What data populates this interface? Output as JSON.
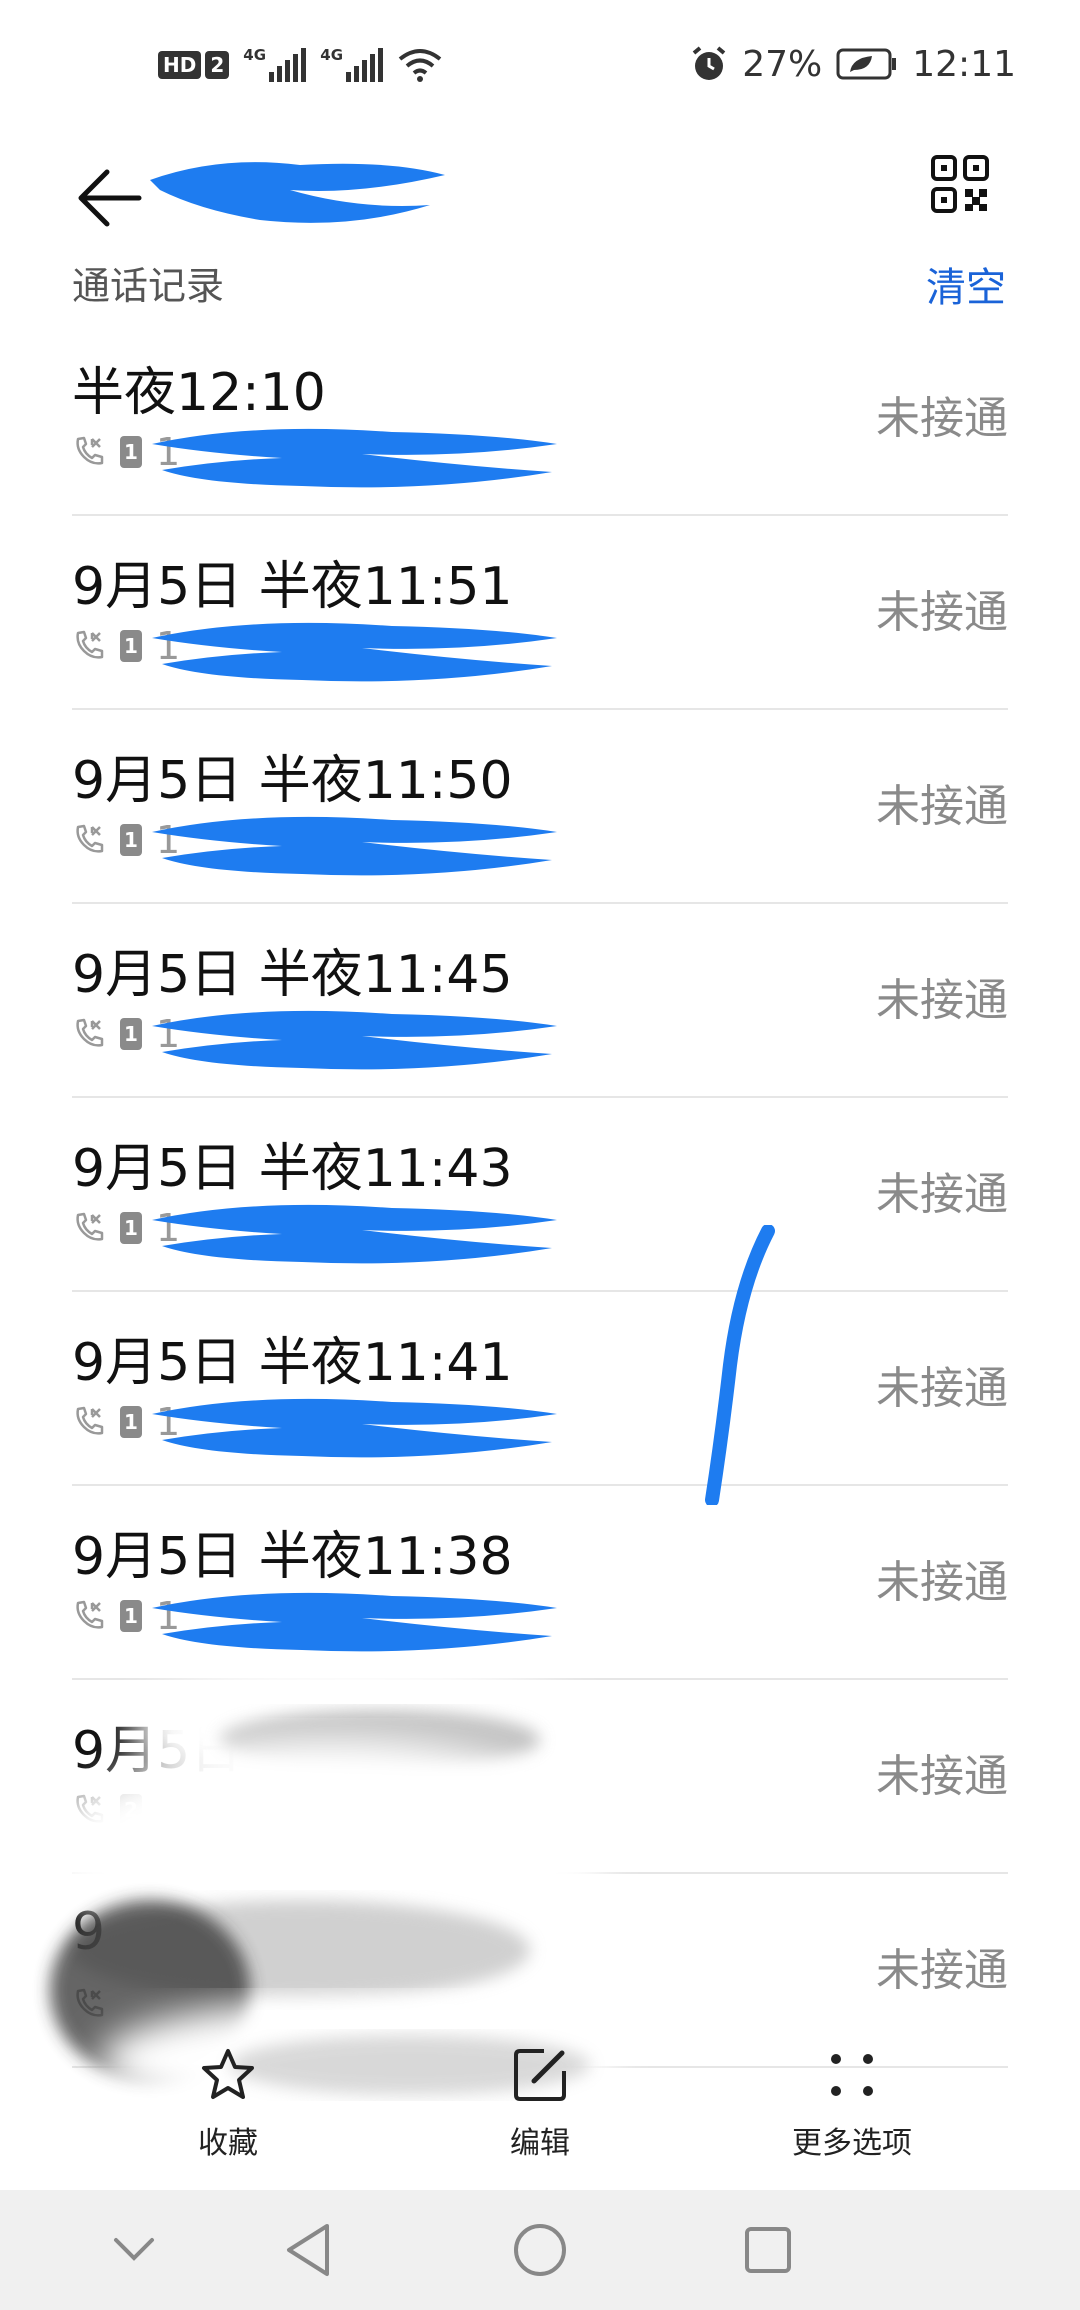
{
  "status_bar": {
    "hd_label": "HD",
    "hd_sim": "2",
    "network_1": "4G",
    "network_2": "4G",
    "battery_percent": "27%",
    "time": "12:11",
    "icons": [
      "signal-icon",
      "wifi-icon",
      "alarm-icon",
      "battery-icon"
    ]
  },
  "header": {
    "contact_name_redacted": true,
    "icons": [
      "back-arrow-icon",
      "qr-code-icon"
    ]
  },
  "section": {
    "title": "通话记录",
    "clear_label": "清空"
  },
  "calls": [
    {
      "time": "半夜12:10",
      "sim": "1",
      "number": "1",
      "status": "未接通"
    },
    {
      "time": "9月5日 半夜11:51",
      "sim": "1",
      "number": "1",
      "status": "未接通"
    },
    {
      "time": "9月5日 半夜11:50",
      "sim": "1",
      "number": "1",
      "status": "未接通"
    },
    {
      "time": "9月5日 半夜11:45",
      "sim": "1",
      "number": "1",
      "status": "未接通"
    },
    {
      "time": "9月5日 半夜11:43",
      "sim": "1",
      "number": "1",
      "status": "未接通"
    },
    {
      "time": "9月5日 半夜11:41",
      "sim": "1",
      "number": "1",
      "status": "未接通"
    },
    {
      "time": "9月5日 半夜11:38",
      "sim": "1",
      "number": "1",
      "status": "未接通"
    },
    {
      "time": "9月5日",
      "sim": "2",
      "number": "",
      "status": "未接通"
    },
    {
      "time": "9",
      "sim": "",
      "number": "",
      "status": "未接通"
    }
  ],
  "toolbar": {
    "favorite_label": "收藏",
    "edit_label": "编辑",
    "more_label": "更多选项"
  },
  "colors": {
    "accent": "#1a63d8",
    "redaction": "#1e7cf0",
    "status_text": "#8a8a8a",
    "nav_bg": "#f0f0f0"
  }
}
